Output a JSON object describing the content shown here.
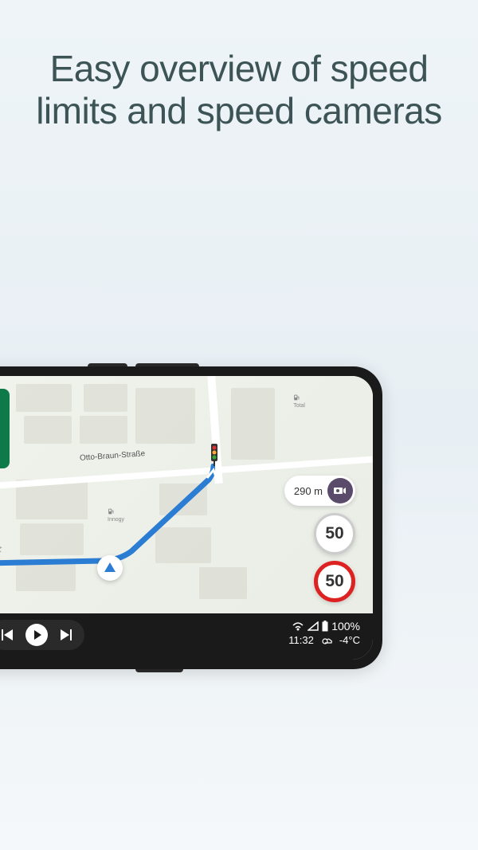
{
  "headline": "Easy overview of speed limits and speed cameras",
  "map": {
    "street_name": "Otto-Braun-Straße",
    "fuel_stations": [
      {
        "name": "Total"
      },
      {
        "name": "Innogy"
      }
    ],
    "camera": {
      "distance": "290 m"
    },
    "speed_limit": "50",
    "current_speed": "50"
  },
  "status_bar": {
    "battery": "100%",
    "time": "11:32",
    "temperature": "-4°C"
  }
}
